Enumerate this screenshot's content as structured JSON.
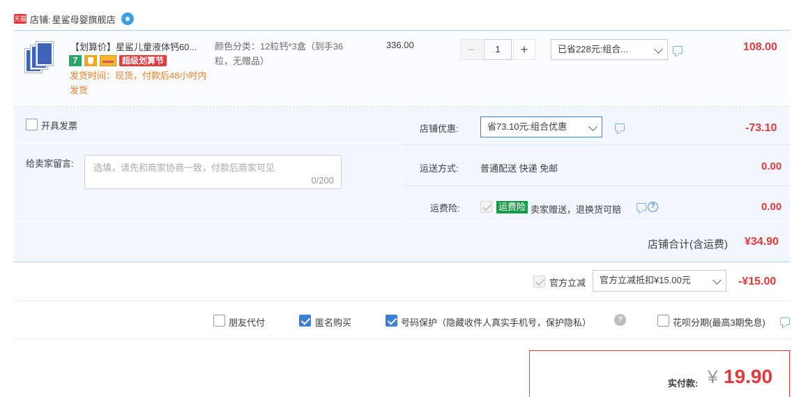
{
  "shop": {
    "badge": "天猫",
    "label": "店铺:",
    "name": "星鲨母婴旗舰店"
  },
  "item": {
    "title": "【划算价】星鲨儿童液体钙60...",
    "tag_seven": "7",
    "tag_promo": "超级划算节",
    "delivery": "发货时间：现货，付款后48小时内发货",
    "sku": "颜色分类：12粒钙*3盒（到手36粒，无赠品）",
    "unit_price": "336.00",
    "qty_minus": "−",
    "qty": "1",
    "qty_plus": "+",
    "discount_select": "已省228元:组合...",
    "subtotal": "108.00"
  },
  "invoice": {
    "label": "开具发票",
    "checked": false
  },
  "message": {
    "label": "给卖家留言:",
    "placeholder": "选填，请先和商家协商一致，付款后商家可见",
    "counter": "0/200"
  },
  "shop_discount": {
    "label": "店铺优惠:",
    "select": "省73.10元:组合优惠",
    "amount": "-73.10"
  },
  "shipping": {
    "label": "运送方式:",
    "value": "普通配送 快递 免邮",
    "amount": "0.00"
  },
  "insurance": {
    "label": "运费险:",
    "tag": "运费险",
    "text": "卖家赠送，退换货可赔",
    "amount": "0.00"
  },
  "shop_total": {
    "label": "店铺合计(含运费)",
    "amount": "¥34.90"
  },
  "official": {
    "label": "官方立减",
    "select": "官方立减抵扣¥15.00元",
    "amount": "-¥15.00"
  },
  "options": {
    "friend_pay": "朋友代付",
    "anonymous": "匿名购买",
    "phone_protect": "号码保护（隐藏收件人真实手机号，保护隐私）",
    "help": "?",
    "huabei": "花呗分期(最高3期免息)"
  },
  "payment": {
    "label": "实付款:",
    "yen": "¥",
    "amount": "19.90"
  },
  "colors": {
    "accent_red": "#e4393c",
    "blue": "#3e7fd6",
    "panel_bg": "#f2f7ff"
  }
}
